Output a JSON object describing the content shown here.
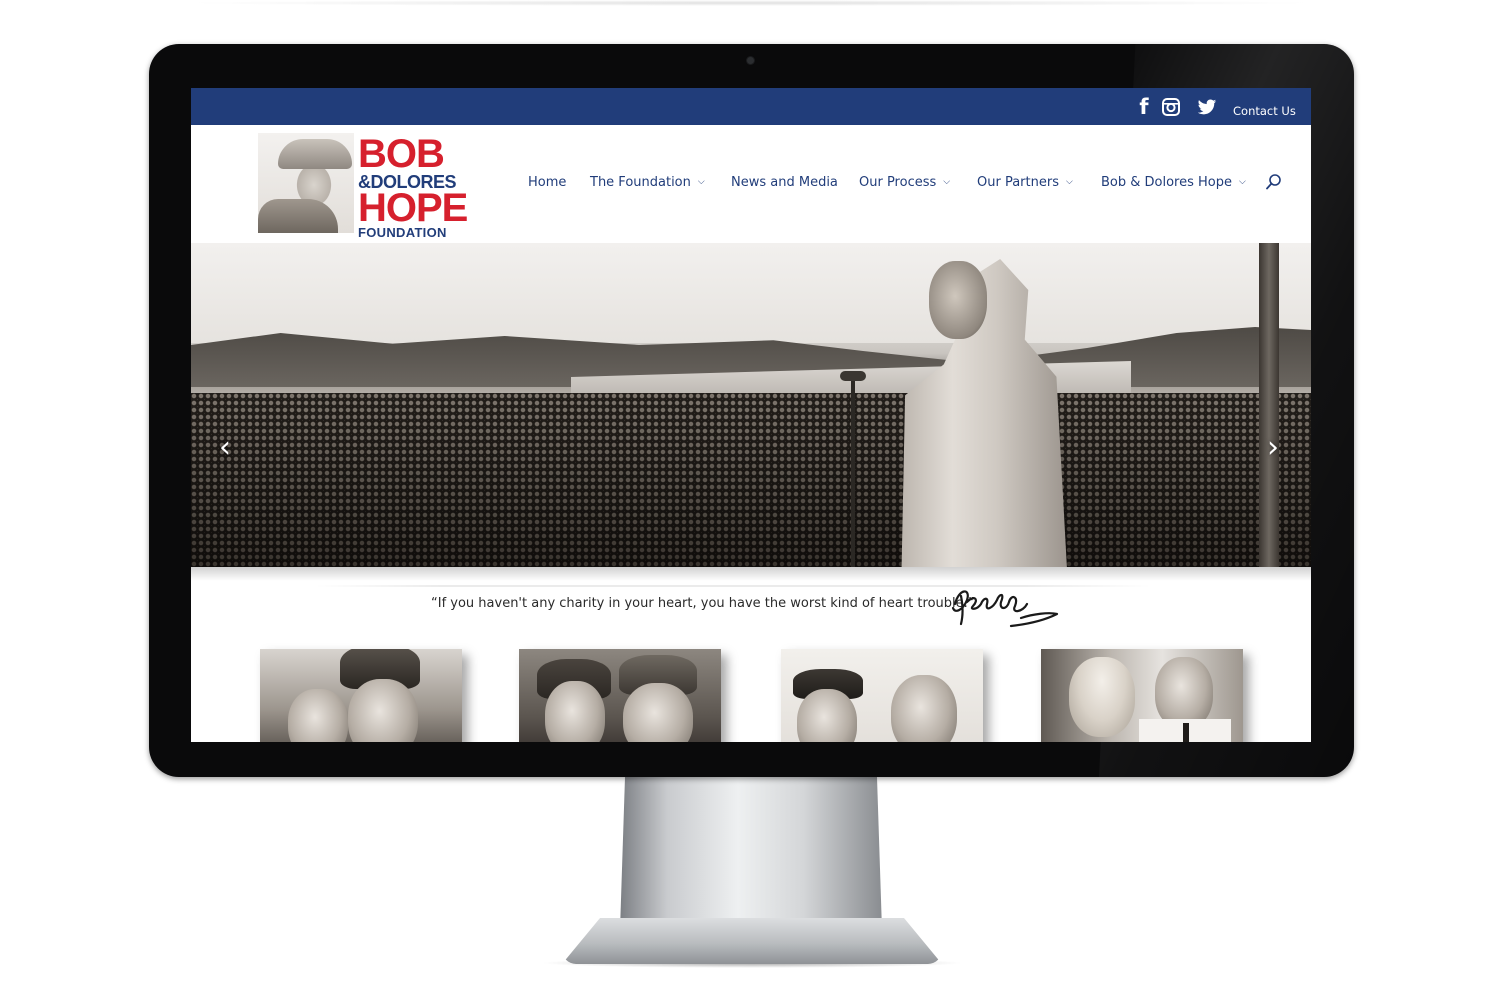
{
  "topbar": {
    "social_icons": [
      "facebook-icon",
      "instagram-icon",
      "twitter-icon"
    ],
    "contact_label": "Contact Us",
    "background": "#213d7a"
  },
  "logo": {
    "line1": "BOB",
    "line2": "&DOLORES",
    "line3": "HOPE",
    "line4": "FOUNDATION",
    "red": "#d6202d",
    "blue": "#213d7a"
  },
  "nav": {
    "items": [
      {
        "label": "Home",
        "has_dropdown": false
      },
      {
        "label": "The Foundation",
        "has_dropdown": true
      },
      {
        "label": "News and Media",
        "has_dropdown": false
      },
      {
        "label": "Our Process",
        "has_dropdown": true
      },
      {
        "label": "Our Partners",
        "has_dropdown": true
      },
      {
        "label": "Bob & Dolores Hope",
        "has_dropdown": true
      }
    ],
    "search_icon": "search-icon"
  },
  "hero": {
    "prev_icon": "chevron-left-icon",
    "next_icon": "chevron-right-icon",
    "prev_glyph": "‹",
    "next_glyph": "›"
  },
  "quote": {
    "text": "“If you haven't any charity in your heart, you have the worst kind of heart trouble.”"
  },
  "thumbnails": [
    "thumbnail-1",
    "thumbnail-2",
    "thumbnail-3",
    "thumbnail-4"
  ]
}
